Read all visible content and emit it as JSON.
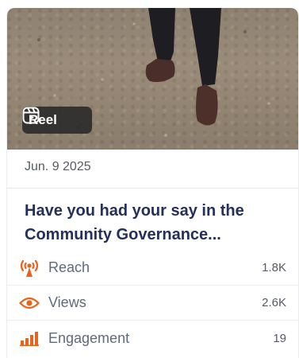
{
  "post": {
    "badge_label": "Reel",
    "date": "Jun. 9 2025",
    "title": "Have you had your say in the Community Governance..."
  },
  "metrics": [
    {
      "label": "Reach",
      "value": "1.8K",
      "icon": "broadcast-icon"
    },
    {
      "label": "Views",
      "value": "2.6K",
      "icon": "eye-icon"
    },
    {
      "label": "Engagement",
      "value": "19",
      "icon": "bar-chart-icon"
    }
  ],
  "colors": {
    "accent": "#e8641c",
    "title": "#25305a",
    "text_muted": "#606a78"
  }
}
